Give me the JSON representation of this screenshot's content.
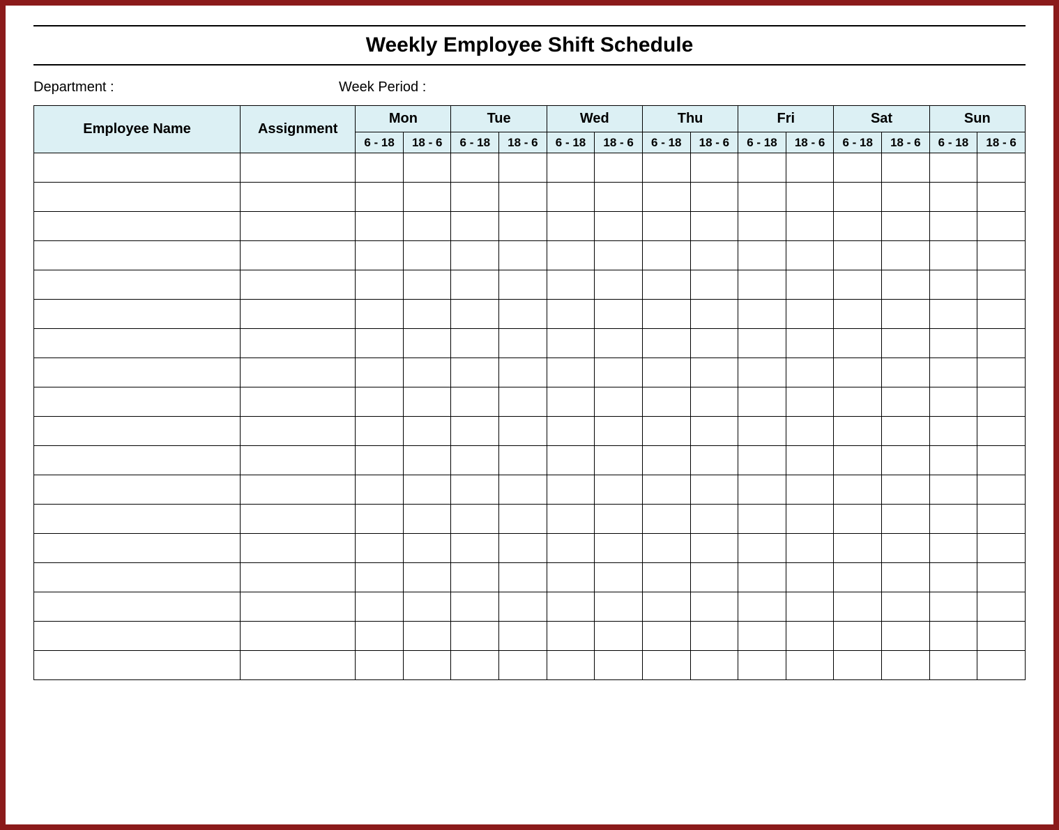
{
  "title": "Weekly Employee Shift Schedule",
  "meta": {
    "department_label": "Department :",
    "week_period_label": "Week  Period :"
  },
  "headers": {
    "employee_name": "Employee Name",
    "assignment": "Assignment",
    "days": [
      "Mon",
      "Tue",
      "Wed",
      "Thu",
      "Fri",
      "Sat",
      "Sun"
    ],
    "shifts": [
      "6 - 18",
      "18 - 6"
    ]
  },
  "row_count": 18,
  "colors": {
    "frame_border": "#8b1a1a",
    "header_bg": "#dcf0f4"
  }
}
